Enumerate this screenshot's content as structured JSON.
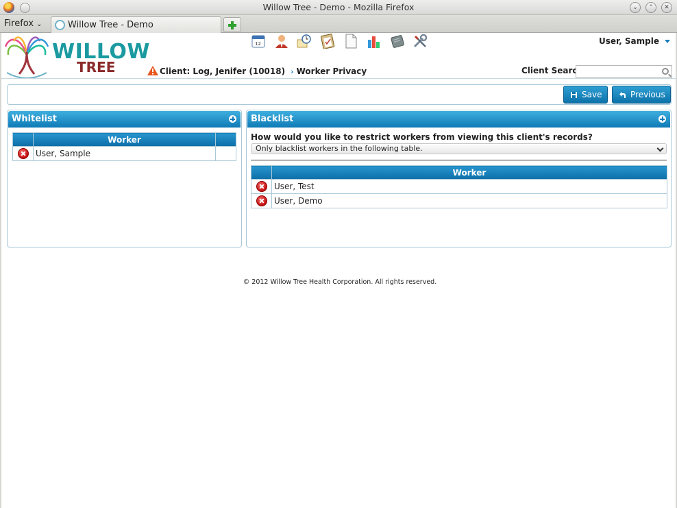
{
  "window": {
    "title": "Willow Tree - Demo - Mozilla Firefox",
    "menu_label": "Firefox",
    "tab_label": "Willow Tree - Demo"
  },
  "header": {
    "logo_word1": "WILLOW",
    "logo_word2": "TREE",
    "user_name": "User, Sample",
    "breadcrumb_client": "Client: Log, Jenifer (10018)",
    "breadcrumb_page": "Worker Privacy",
    "client_search_label": "Client Search",
    "client_search_value": "",
    "toolbar_icons": [
      "calendar-icon",
      "person-icon",
      "clock-icon",
      "clipboard-icon",
      "document-icon",
      "bar-chart-icon",
      "notebook-icon",
      "tools-icon"
    ]
  },
  "actions": {
    "save_label": "Save",
    "previous_label": "Previous"
  },
  "whitelist": {
    "title": "Whitelist",
    "column": "Worker",
    "rows": [
      "User, Sample"
    ]
  },
  "blacklist": {
    "title": "Blacklist",
    "question": "How would you like to restrict workers from viewing this client's records?",
    "selected_option": "Only blacklist workers in the following table.",
    "column": "Worker",
    "rows": [
      "User, Test",
      "User, Demo"
    ]
  },
  "footer": {
    "text": "© 2012 Willow Tree Health Corporation. All rights reserved."
  },
  "colors": {
    "accent": "#0f7ab6",
    "logo_teal": "#1a9aa0",
    "logo_maroon": "#8a2a2a",
    "delete_red": "#c41010"
  }
}
